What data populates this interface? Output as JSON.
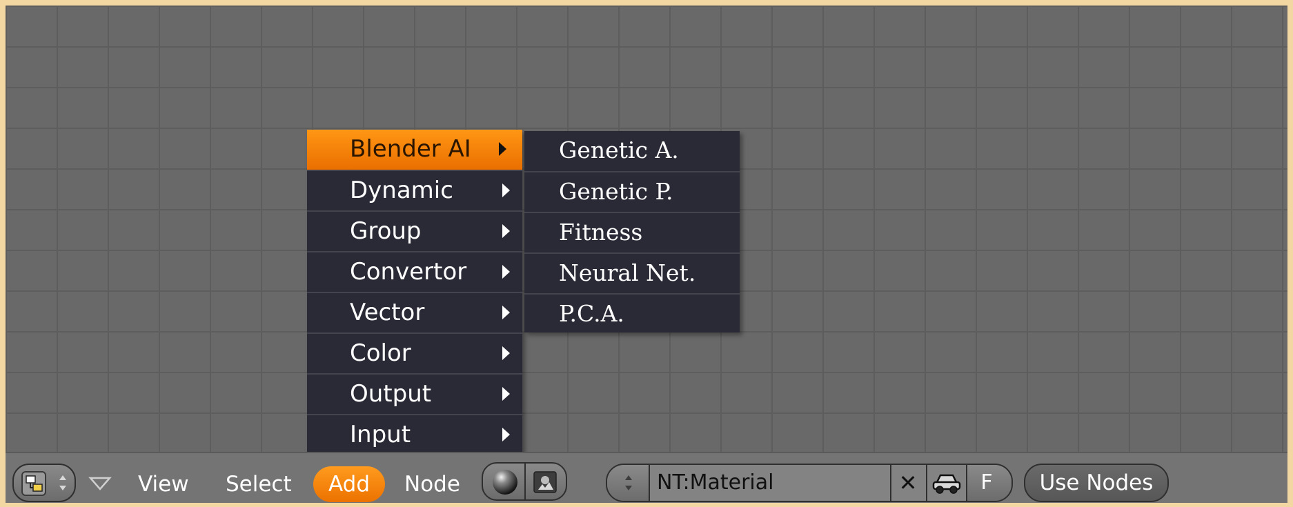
{
  "colors": {
    "frame": "#f2d7a3",
    "editor_bg": "#696969",
    "grid_line": "#5d5d5d",
    "menu_bg": "#2a2a36",
    "accent": "#f18008",
    "text": "#ffffff"
  },
  "add_menu": {
    "items": [
      {
        "label": "Blender AI",
        "active": true
      },
      {
        "label": "Dynamic"
      },
      {
        "label": "Group"
      },
      {
        "label": "Convertor"
      },
      {
        "label": "Vector"
      },
      {
        "label": "Color"
      },
      {
        "label": "Output"
      },
      {
        "label": "Input"
      }
    ]
  },
  "submenu": {
    "items": [
      {
        "label": "Genetic A."
      },
      {
        "label": "Genetic P."
      },
      {
        "label": "Fitness"
      },
      {
        "label": "Neural Net."
      },
      {
        "label": "P.C.A."
      }
    ]
  },
  "header": {
    "editor_type_icon": "node-editor-icon",
    "menus": {
      "view": "View",
      "select": "Select",
      "add": "Add",
      "node": "Node"
    },
    "shader_icon": "material-sphere-icon",
    "composite_icon": "composite-icon",
    "nodetree_field": "NT:Material",
    "close_label": "✕",
    "car_icon": "car-icon",
    "fake_user_label": "F",
    "use_nodes_label": "Use Nodes"
  }
}
